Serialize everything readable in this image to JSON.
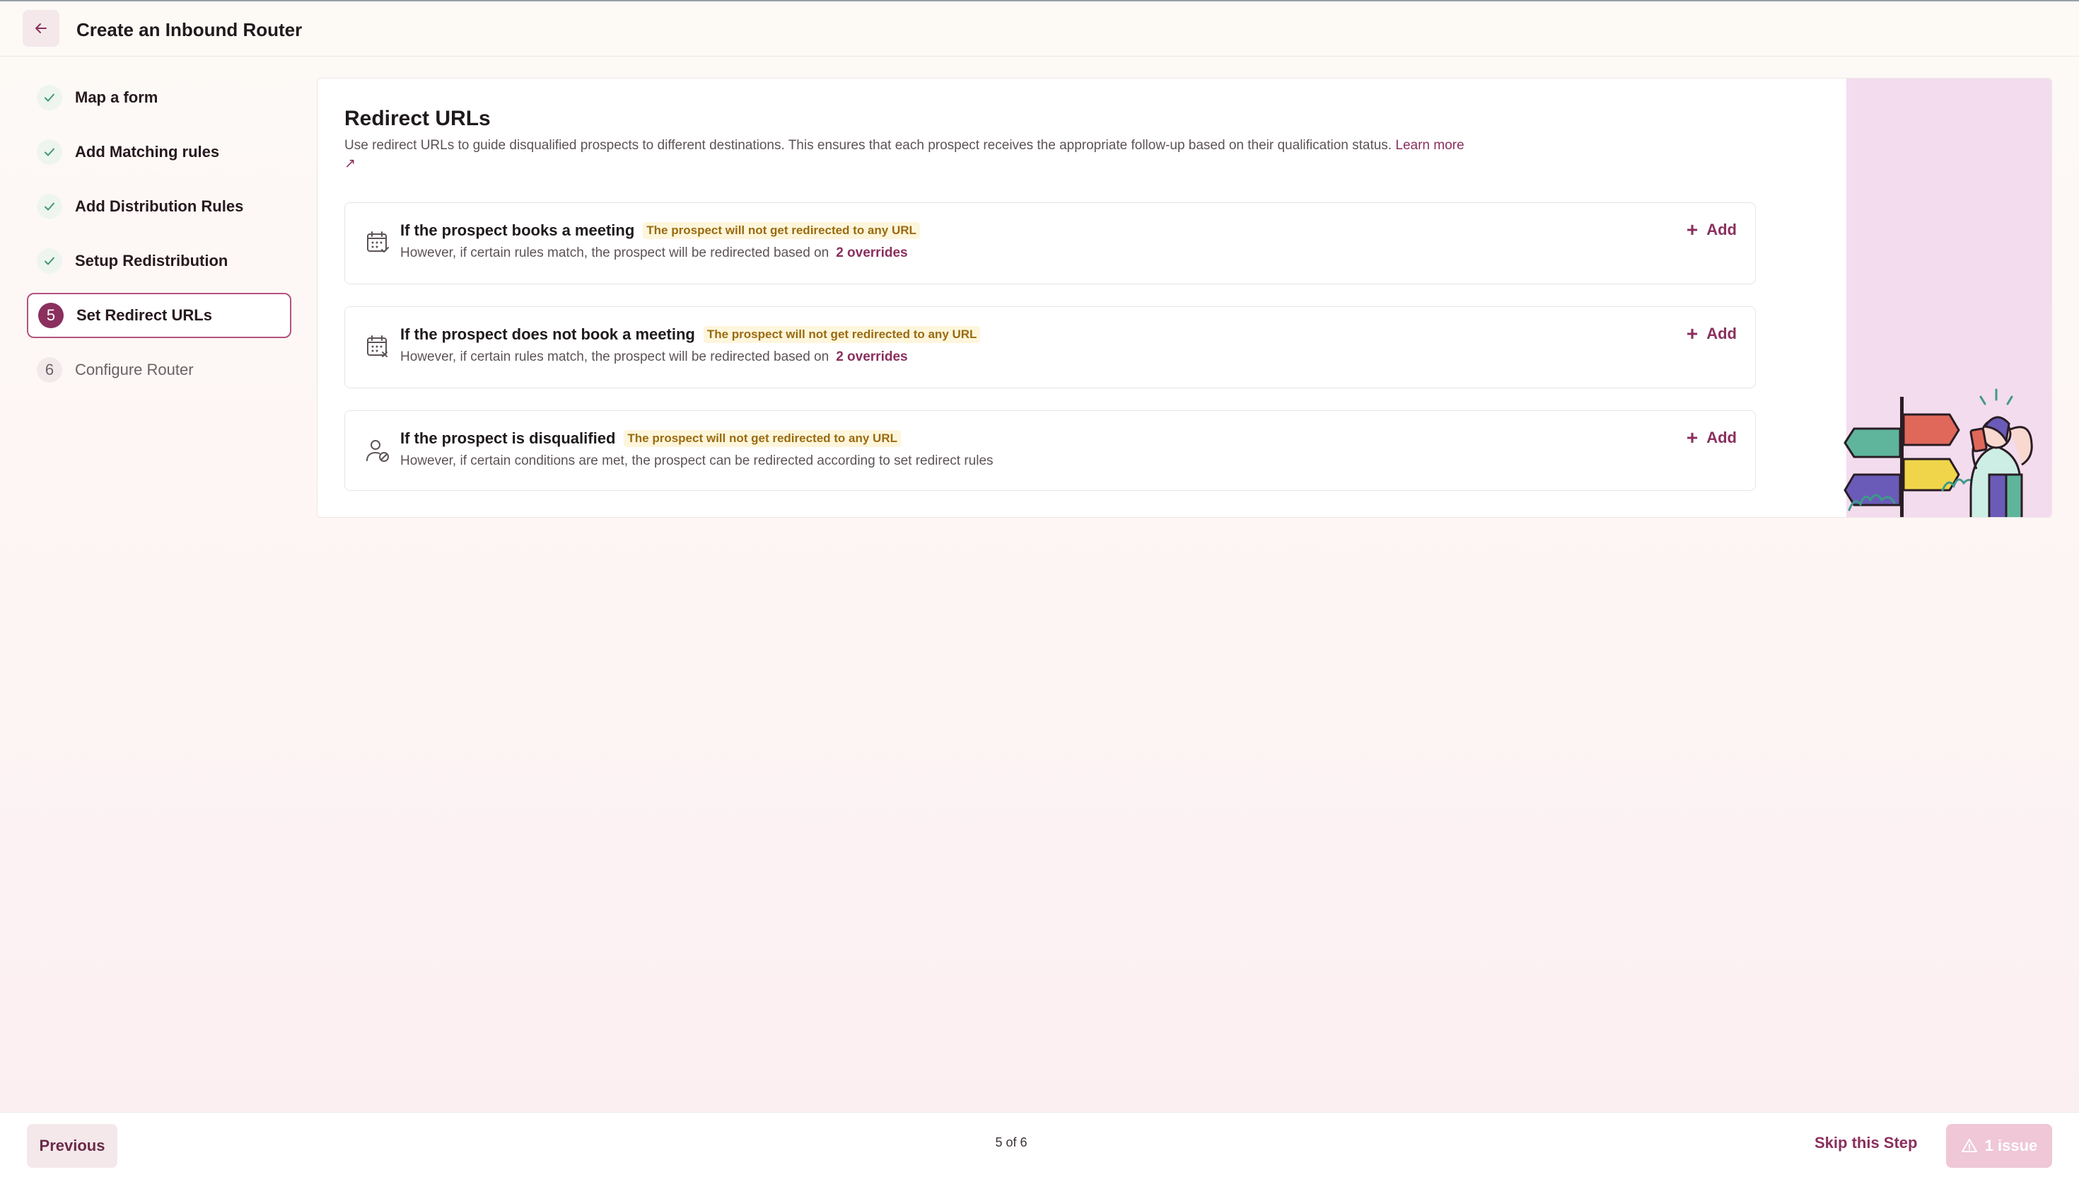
{
  "header": {
    "back_icon": "arrow-left-icon",
    "title": "Create an Inbound Router"
  },
  "steps": [
    {
      "label": "Map a form",
      "state": "done"
    },
    {
      "label": "Add Matching rules",
      "state": "done"
    },
    {
      "label": "Add Distribution Rules",
      "state": "done"
    },
    {
      "label": "Setup Redistribution",
      "state": "done"
    },
    {
      "number": "5",
      "label": "Set Redirect URLs",
      "state": "current"
    },
    {
      "number": "6",
      "label": "Configure Router",
      "state": "todo"
    }
  ],
  "main": {
    "title": "Redirect URLs",
    "description": "Use redirect URLs to guide disqualified prospects to different destinations. This ensures that each prospect receives the appropriate follow-up based on their qualification status.",
    "learn_more": "Learn more ↗",
    "rules": [
      {
        "icon": "calendar-check-icon",
        "heading": "If the prospect books a meeting",
        "badge": "The prospect will not get redirected to any URL",
        "sub": "However, if certain rules match, the prospect will be redirected based on",
        "overrides": "2 overrides",
        "add_label": "Add"
      },
      {
        "icon": "calendar-x-icon",
        "heading": "If the prospect does not book a meeting",
        "badge": "The prospect will not get redirected to any URL",
        "sub": "However, if certain rules match, the prospect will be redirected based on",
        "overrides": "2 overrides",
        "add_label": "Add"
      },
      {
        "icon": "user-blocked-icon",
        "heading": "If the prospect is disqualified",
        "badge": "The prospect will not get redirected to any URL",
        "sub": "However, if certain conditions are met, the prospect can be redirected according to set redirect rules",
        "add_label": "Add"
      }
    ]
  },
  "footer": {
    "previous": "Previous",
    "page_indicator": "5 of 6",
    "skip": "Skip this Step",
    "issue": "1 issue"
  },
  "colors": {
    "accent": "#8a2f5e",
    "badge_text": "#9a6b10",
    "badge_bg": "#fdf6dc",
    "illustration_bg": "#f3dcee"
  }
}
